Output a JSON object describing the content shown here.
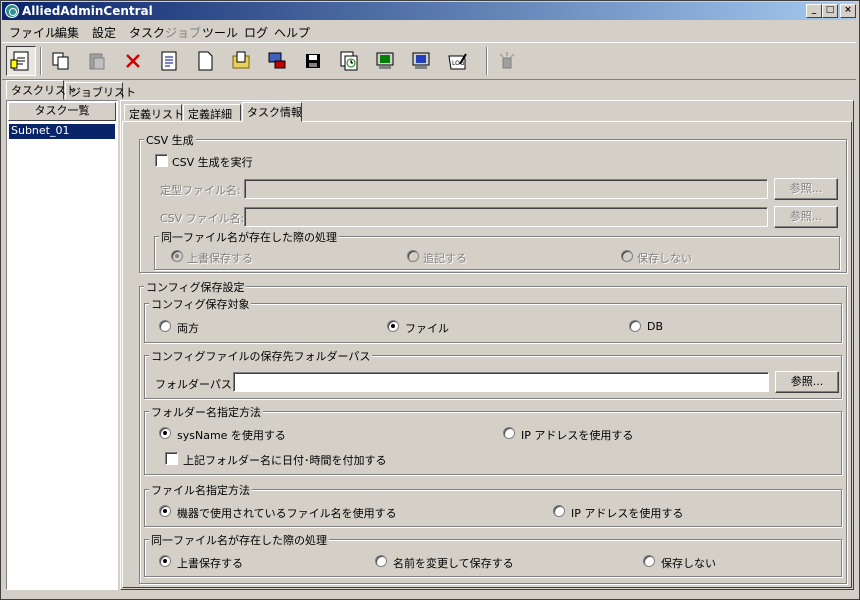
{
  "window": {
    "title": "AlliedAdminCentral"
  },
  "menu": [
    "ファイル",
    "編集",
    "設定",
    "タスク",
    "ジョブ",
    "ツール",
    "ログ",
    "ヘルプ"
  ],
  "left_tabs": [
    "タスクリスト",
    "ジョブリスト"
  ],
  "task_list": {
    "header": "タスク一覧",
    "items": [
      "Subnet_01"
    ]
  },
  "right_tabs": [
    "定義リスト",
    "定義詳細",
    "タスク情報"
  ],
  "csv": {
    "title": "CSV 生成",
    "enable_label": "CSV 生成を実行",
    "template_label": "定型ファイル名:",
    "csvfile_label": "CSV ファイル名:",
    "browse": "参照...",
    "dup_title": "同一ファイル名が存在した際の処理",
    "dup_options": [
      "上書保存する",
      "追記する",
      "保存しない"
    ]
  },
  "config": {
    "title": "コンフィグ保存設定",
    "target_title": "コンフィグ保存対象",
    "target_options": [
      "両方",
      "ファイル",
      "DB"
    ],
    "folder_title": "コンフィグファイルの保存先フォルダーパス",
    "folder_label": "フォルダーパス:",
    "folder_value": "",
    "browse": "参照...",
    "naming_title": "フォルダー名指定方法",
    "naming_options": [
      "sysName を使用する",
      "IP アドレスを使用する"
    ],
    "append_datetime_label": "上記フォルダー名に日付･時間を付加する",
    "filename_title": "ファイル名指定方法",
    "filename_options": [
      "機器で使用されているファイル名を使用する",
      "IP アドレスを使用する"
    ],
    "dup_title": "同一ファイル名が存在した際の処理",
    "dup_options": [
      "上書保存する",
      "名前を変更して保存する",
      "保存しない"
    ]
  }
}
